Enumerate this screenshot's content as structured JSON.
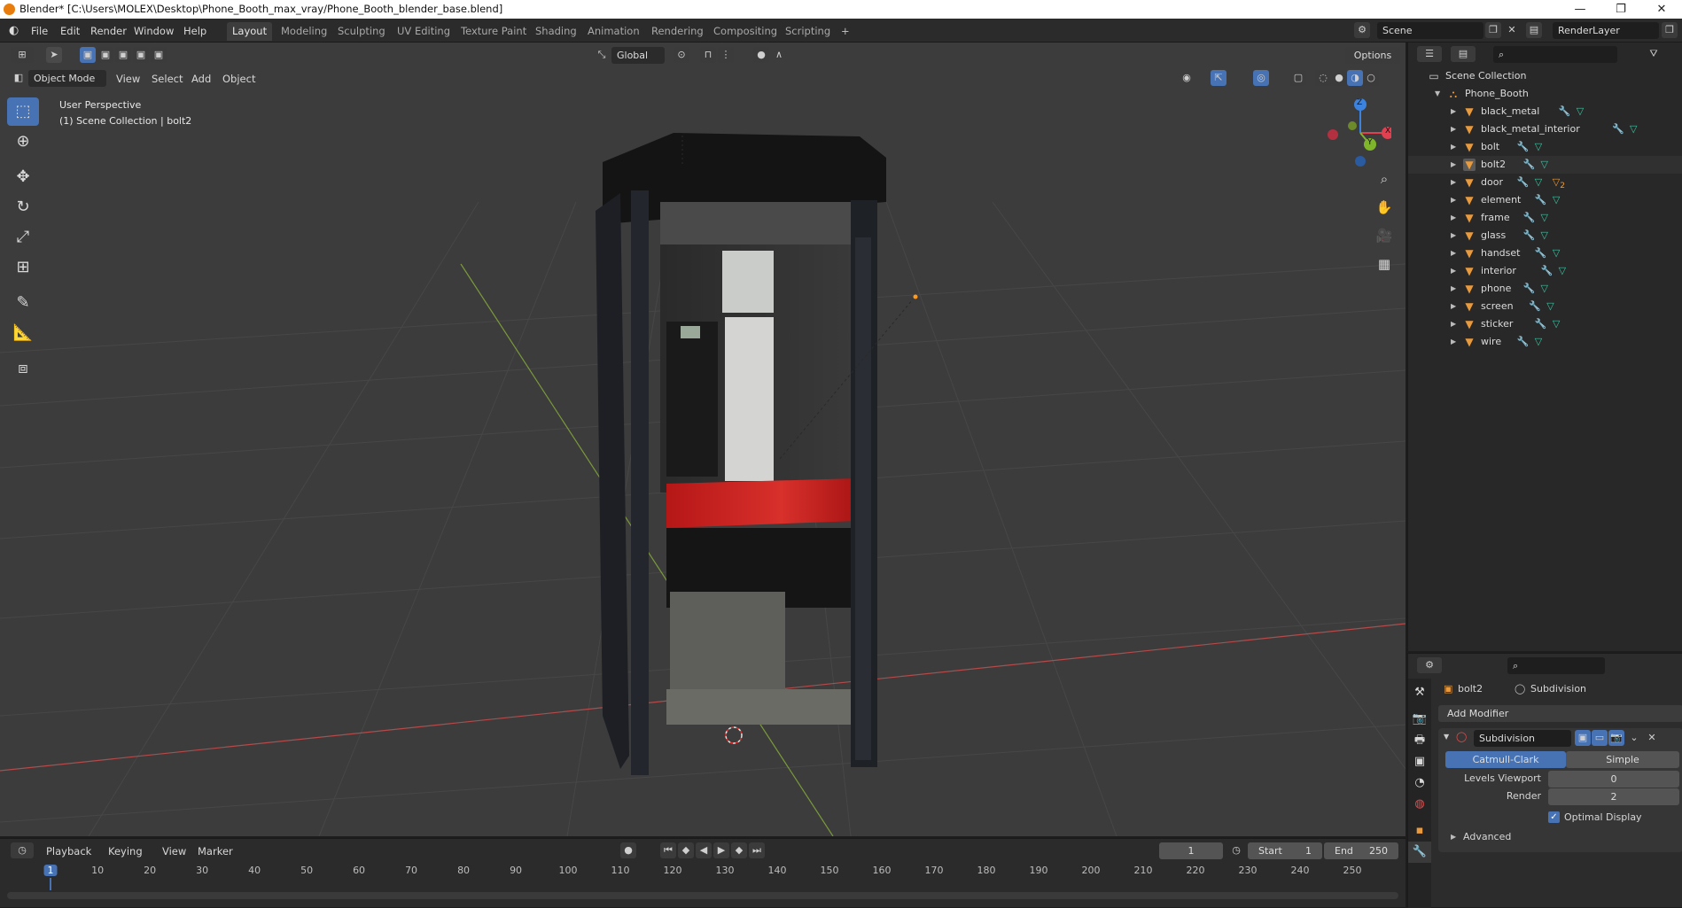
{
  "titlebar": {
    "text": "Blender* [C:\\Users\\MOLEX\\Desktop\\Phone_Booth_max_vray/Phone_Booth_blender_base.blend]",
    "minimize": "—",
    "restore": "❐",
    "close": "✕"
  },
  "menu": [
    "File",
    "Edit",
    "Render",
    "Window",
    "Help"
  ],
  "workspaces": [
    "Layout",
    "Modeling",
    "Sculpting",
    "UV Editing",
    "Texture Paint",
    "Shading",
    "Animation",
    "Rendering",
    "Compositing",
    "Scripting"
  ],
  "active_workspace": "Layout",
  "add_workspace": "+",
  "scene": {
    "name": "Scene",
    "view_layer": "RenderLayer"
  },
  "viewport": {
    "mode": "Object Mode",
    "menus": [
      "View",
      "Select",
      "Add",
      "Object"
    ],
    "orientation": "Global",
    "options": "Options",
    "overlay_title": "User Perspective",
    "overlay_sub": "(1) Scene Collection | bolt2",
    "gizmo": {
      "x": "X",
      "y": "Y",
      "z": "Z"
    }
  },
  "outliner": {
    "root": "Scene Collection",
    "collection": "Phone_Booth",
    "items": [
      "black_metal",
      "black_metal_interior",
      "bolt",
      "bolt2",
      "door",
      "element",
      "frame",
      "glass",
      "handset",
      "interior",
      "phone",
      "screen",
      "sticker",
      "wire"
    ],
    "door_badge": "2",
    "selected": "bolt2"
  },
  "properties": {
    "object": "bolt2",
    "modifier_tab": "Subdivision",
    "add_modifier": "Add Modifier",
    "modifier_name": "Subdivision",
    "type_a": "Catmull-Clark",
    "type_b": "Simple",
    "levels_label": "Levels Viewport",
    "levels_value": "0",
    "render_label": "Render",
    "render_value": "2",
    "optimal": "Optimal Display",
    "advanced": "Advanced"
  },
  "timeline": {
    "menus": [
      "Playback",
      "Keying",
      "View",
      "Marker"
    ],
    "current_frame": "1",
    "start_label": "Start",
    "start": "1",
    "end_label": "End",
    "end": "250",
    "ticks": [
      "1",
      "10",
      "20",
      "30",
      "40",
      "50",
      "60",
      "70",
      "80",
      "90",
      "100",
      "110",
      "120",
      "130",
      "140",
      "150",
      "160",
      "170",
      "180",
      "190",
      "200",
      "210",
      "220",
      "230",
      "240",
      "250"
    ],
    "tick_values": [
      1,
      10,
      20,
      30,
      40,
      50,
      60,
      70,
      80,
      90,
      100,
      110,
      120,
      130,
      140,
      150,
      160,
      170,
      180,
      190,
      200,
      210,
      220,
      230,
      240,
      250
    ]
  },
  "colors": {
    "accent": "#4772b3",
    "selected_row": "#334d80",
    "red_band": "#c8201e",
    "orange": "#e87d0d"
  }
}
